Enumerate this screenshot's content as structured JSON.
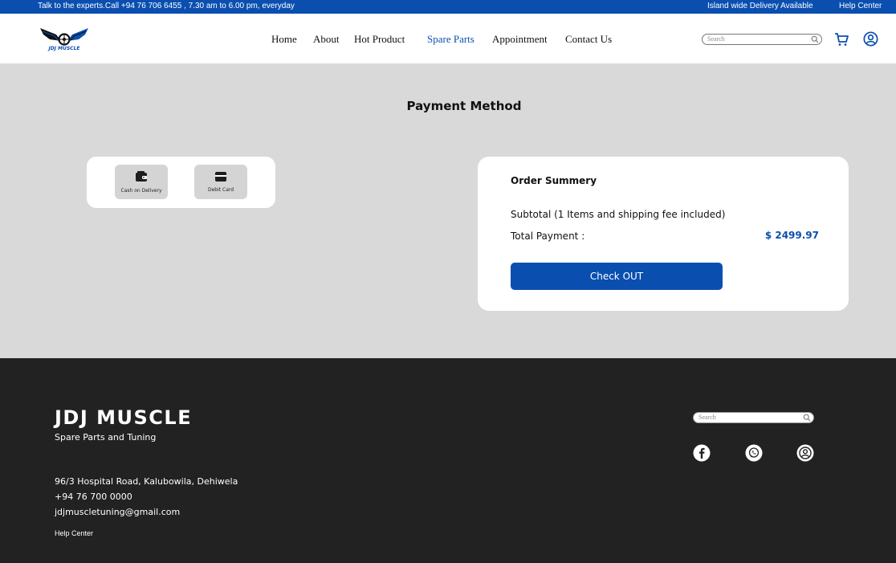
{
  "topbar": {
    "contact_text": "Talk to the experts.Call +94 76 706 6455 , 7.30 am to 6.00 pm, everyday",
    "delivery_text": "Island wide Delivery Available",
    "help_label": "Help Center"
  },
  "header": {
    "logo_text": "JDJ MUSCLE",
    "nav": [
      "Home",
      "About",
      "Hot Product",
      "Spare Parts",
      "Appointment",
      "Contact Us"
    ],
    "active_nav": "Spare Parts",
    "search_placeholder": "Search",
    "icons": [
      "search-icon",
      "cart-icon",
      "user-icon"
    ]
  },
  "page": {
    "title": "Payment Method"
  },
  "payment_methods": [
    {
      "label": "Cash on Delivery",
      "icon": "wallet-icon"
    },
    {
      "label": "Debit Card",
      "icon": "card-icon"
    }
  ],
  "summary": {
    "heading": "Order Summery",
    "subtotal_text": "Subtotal (1 Items and shipping fee included)",
    "total_label": "Total Payment :",
    "total_amount": "$ 2499.97",
    "checkout_label": "Check OUT"
  },
  "footer": {
    "brand": "JDJ MUSCLE",
    "tagline": "Spare Parts and Tuning",
    "address": "96/3 Hospital Road, Kalubowila, Dehiwela",
    "phone": "+94 76 700 0000",
    "email": "jdjmuscletuning@gmail.com",
    "help_label": "Help Center",
    "search_placeholder": "Search",
    "social": [
      "facebook-icon",
      "whatsapp-icon",
      "user-icon"
    ]
  },
  "colors": {
    "brand_blue": "#0a4fb0",
    "footer_bg": "#222222",
    "page_bg": "#d9d9d9"
  }
}
